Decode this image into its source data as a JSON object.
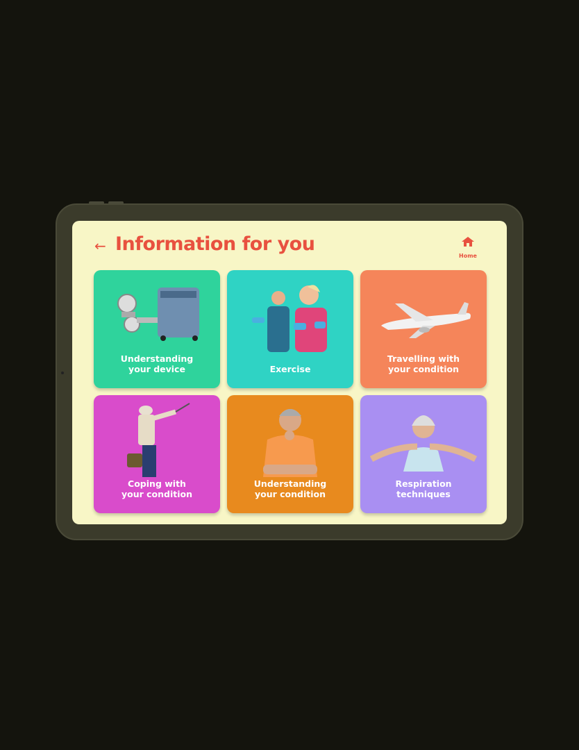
{
  "header": {
    "title": "Information for you",
    "back_label": "←",
    "home_label": "Home"
  },
  "cards": [
    {
      "label": "Understanding\nyour device",
      "color": "#2fd39c",
      "icon": "oxygen-device-image"
    },
    {
      "label": "Exercise",
      "color": "#2fd3c4",
      "icon": "exercise-image"
    },
    {
      "label": "Travelling with\nyour condition",
      "color": "#f5855a",
      "icon": "airplane-image"
    },
    {
      "label": "Coping with\nyour condition",
      "color": "#d94ccb",
      "icon": "fishing-man-image"
    },
    {
      "label": "Understanding\nyour condition",
      "color": "#e88a1e",
      "icon": "thinking-man-image"
    },
    {
      "label": "Respiration\ntechniques",
      "color": "#a98ff2",
      "icon": "breathing-woman-image"
    }
  ],
  "colors": {
    "title": "#e8513f",
    "screen": "#f8f6c6"
  }
}
